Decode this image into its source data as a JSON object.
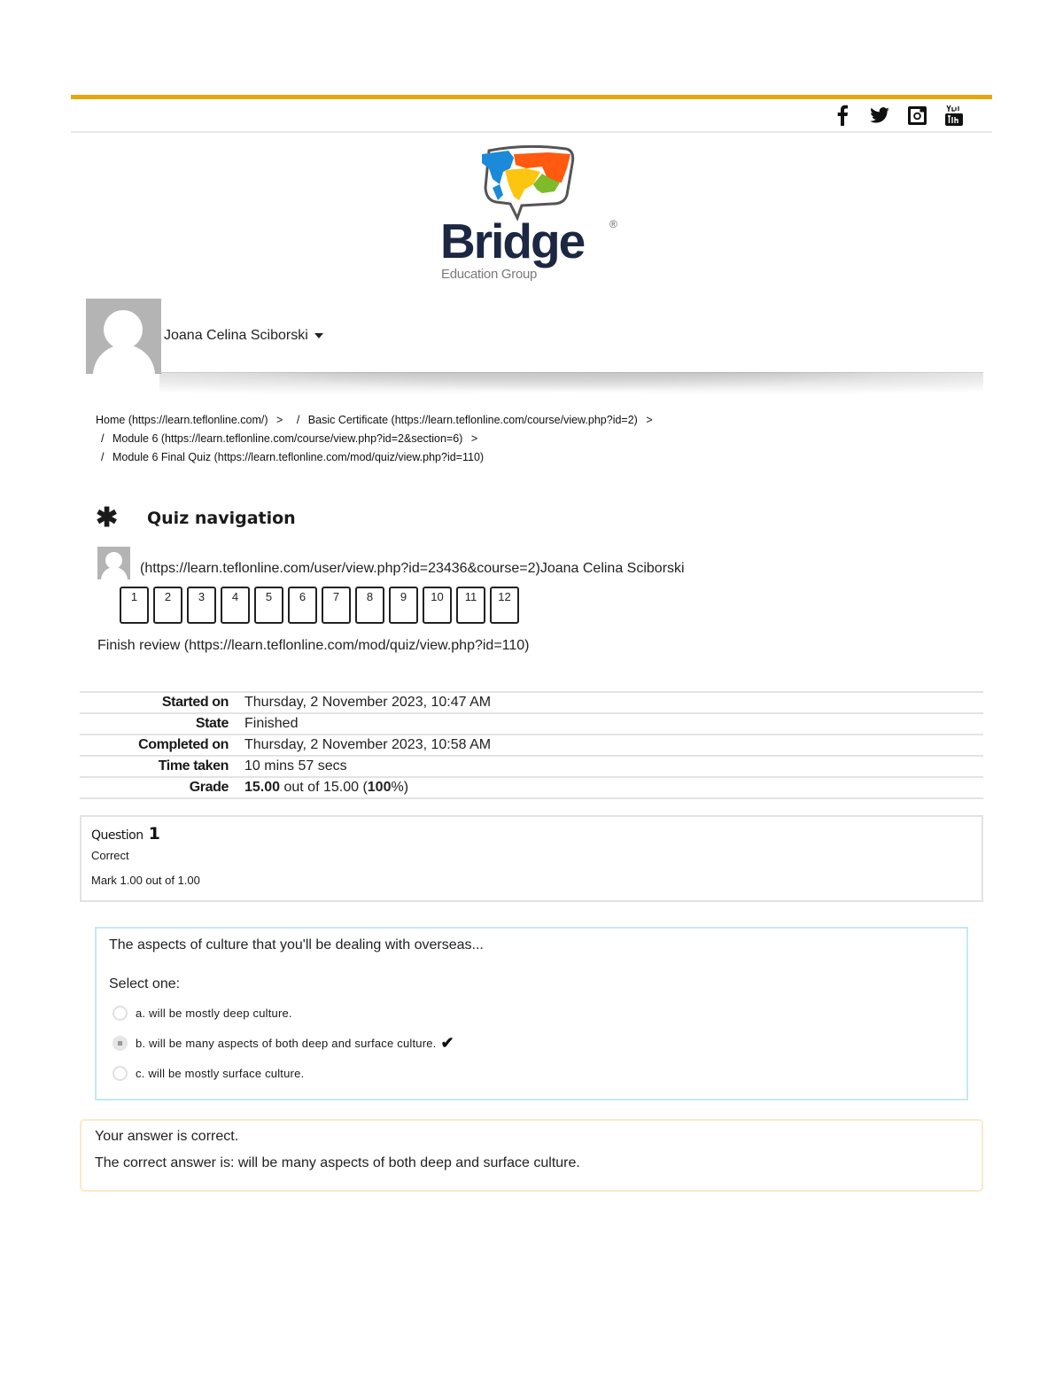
{
  "header": {
    "accent_color": "#e3a80c",
    "social_icons": [
      "facebook-icon",
      "twitter-icon",
      "instagram-icon",
      "youtube-icon"
    ]
  },
  "logo": {
    "word": "Bridge",
    "registered": "®",
    "subtitle": "Education Group",
    "colors": {
      "blue": "#1b8ad8",
      "orange": "#ff5a0f",
      "yellow": "#fcc50f",
      "green": "#7dbb2b",
      "navy": "#1c2743"
    }
  },
  "user": {
    "name": "Joana Celina Sciborski"
  },
  "breadcrumb": {
    "items": [
      {
        "label": "Home (https://learn.teflonline.com/)",
        "separator_after": ">"
      },
      {
        "label": "Basic Certificate (https://learn.teflonline.com/course/view.php?id=2)",
        "separator_after": ">"
      },
      {
        "label": "Module 6 (https://learn.teflonline.com/course/view.php?id=2&section=6)",
        "separator_after": ">"
      },
      {
        "label": "Module 6 Final Quiz (https://learn.teflonline.com/mod/quiz/view.php?id=110)",
        "separator_after": ""
      }
    ],
    "slash": "/"
  },
  "quiz_nav": {
    "title": "Quiz navigation",
    "icon": "asterisk",
    "user_link": "(https://learn.teflonline.com/user/view.php?id=23436&course=2)Joana Celina Sciborski",
    "questions": [
      "1",
      "2",
      "3",
      "4",
      "5",
      "6",
      "7",
      "8",
      "9",
      "10",
      "11",
      "12"
    ],
    "finish_review": "Finish review (https://learn.teflonline.com/mod/quiz/view.php?id=110)"
  },
  "summary": {
    "rows": [
      {
        "label": "Started on",
        "value": "Thursday, 2 November 2023, 10:47 AM"
      },
      {
        "label": "State",
        "value": "Finished"
      },
      {
        "label": "Completed on",
        "value": "Thursday, 2 November 2023, 10:58 AM"
      },
      {
        "label": "Time taken",
        "value": "10 mins 57 secs"
      }
    ],
    "grade": {
      "label": "Grade",
      "score": "15.00",
      "out_of_text": " out of 15.00 (",
      "percent": "100",
      "suffix": "%)"
    }
  },
  "question": {
    "label": "Question",
    "number": "1",
    "state": "Correct",
    "mark": "Mark 1.00 out of 1.00",
    "text": "The aspects of culture that you'll be dealing with overseas...",
    "prompt": "Select one:",
    "answers": [
      {
        "label": "a. will be mostly deep culture.",
        "selected": false,
        "correct": false
      },
      {
        "label": "b. will be many aspects of both deep and surface culture.",
        "selected": true,
        "correct": true
      },
      {
        "label": "c. will be mostly surface culture.",
        "selected": false,
        "correct": false
      }
    ],
    "feedback": {
      "result": "Your answer is correct.",
      "correct_answer": "The correct answer is: will be many aspects of both deep and surface culture."
    }
  }
}
